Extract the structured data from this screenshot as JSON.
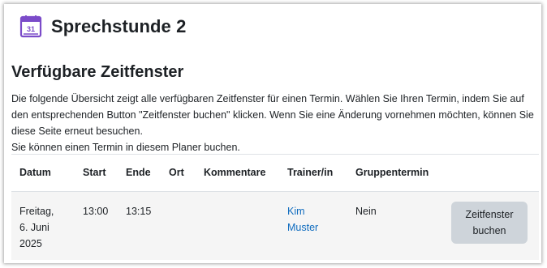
{
  "header": {
    "title": "Sprechstunde 2",
    "icon": "calendar-icon",
    "icon_number": "31",
    "icon_color": "#7b4bc9"
  },
  "section": {
    "title": "Verfügbare Zeitfenster"
  },
  "intro": {
    "paragraph1": "Die folgende Übersicht zeigt alle verfügbaren Zeitfenster für einen Termin. Wählen Sie Ihren Termin, indem Sie auf den entsprechenden Button \"Zeitfenster buchen\" klicken. Wenn Sie eine Änderung vornehmen möchten, können Sie diese Seite erneut besuchen.",
    "paragraph2": "Sie können einen Termin in diesem Planer buchen."
  },
  "table": {
    "headers": [
      "Datum",
      "Start",
      "Ende",
      "Ort",
      "Kommentare",
      "Trainer/in",
      "Gruppentermin",
      ""
    ],
    "rows": [
      {
        "date_line1": "Freitag,",
        "date_line2": "6. Juni",
        "date_line3": "2025",
        "start": "13:00",
        "end": "13:15",
        "location": "",
        "comments": "",
        "trainer_line1": "Kim",
        "trainer_line2": "Muster",
        "group": "Nein",
        "button_line1": "Zeitfenster",
        "button_line2": "buchen"
      }
    ]
  },
  "colors": {
    "link": "#0f6cbf",
    "button_bg": "#ced4da",
    "row_bg": "#f5f5f5"
  }
}
